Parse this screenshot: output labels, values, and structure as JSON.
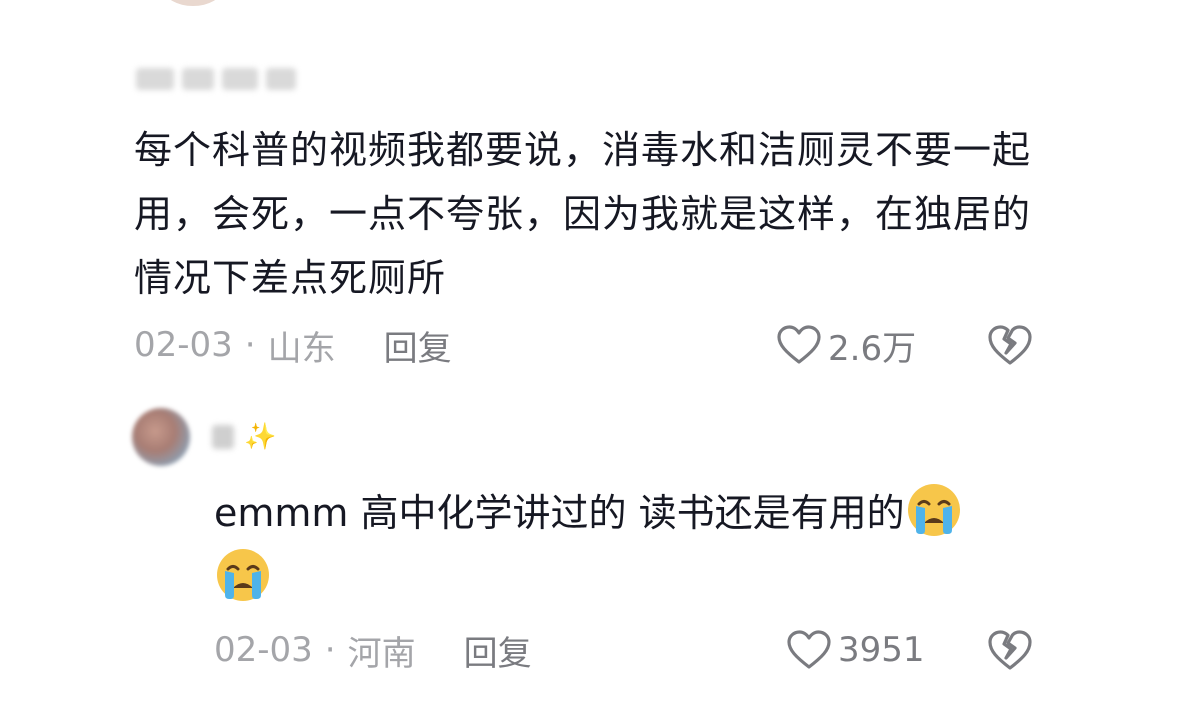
{
  "comment": {
    "text": "每个科普的视频我都要说，消毒水和洁厕灵不要一起用，会死，一点不夸张，因为我就是这样，在独居的情况下差点死厕所",
    "date": "02-03",
    "separator": "·",
    "location": "山东",
    "reply_label": "回复",
    "likes": "2.6万"
  },
  "reply": {
    "text": "emmm 高中化学讲过的 读书还是有用的",
    "date": "02-03",
    "separator": "·",
    "location": "河南",
    "reply_label": "回复",
    "likes": "3951"
  },
  "colors": {
    "text": "#161823",
    "meta": "#a4a5a9",
    "action": "#7a7b80",
    "emoji_face": "#f7c64a",
    "emoji_tear": "#4fb3ea"
  },
  "icons": [
    "heart-outline-icon",
    "broken-heart-icon",
    "sparkle-icon",
    "crying-face-emoji"
  ]
}
